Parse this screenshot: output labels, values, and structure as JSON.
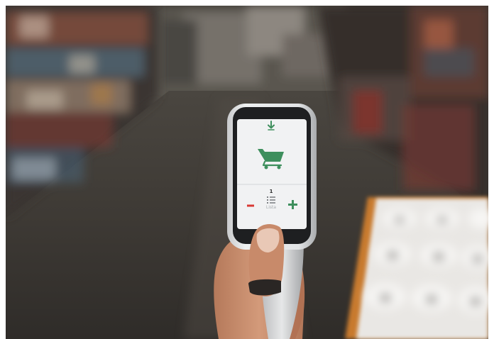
{
  "scene": {
    "screen": {
      "item_count": "1",
      "list_label": "Lista",
      "icons": [
        "download-arrow-icon",
        "shopping-cart-icon",
        "list-icon",
        "minus-icon",
        "plus-icon"
      ],
      "colors": {
        "accent_green": "#3e8f5d",
        "minus_red": "#d93a34",
        "scanner_body": "#e4e5e6",
        "scanner_bezel": "#1e1f21"
      }
    }
  }
}
